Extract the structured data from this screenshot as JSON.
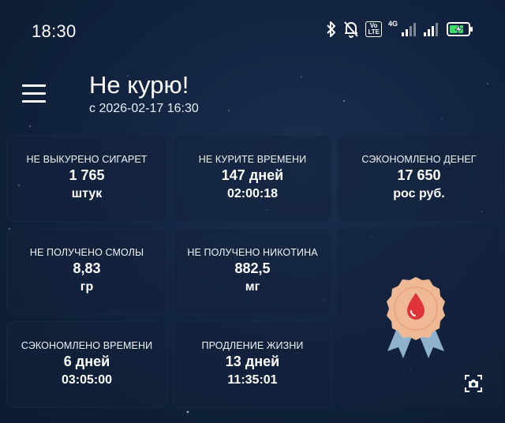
{
  "status_bar": {
    "time": "18:30",
    "volte_top": "Vo",
    "volte_bottom": "LTE",
    "network_type": "4G",
    "icons": [
      "bluetooth-icon",
      "bell-off-icon",
      "volte-icon",
      "signal-icon",
      "signal-icon",
      "battery-charging-icon"
    ]
  },
  "app_bar": {
    "title": "Не курю!",
    "subtitle": "с 2026-02-17 16:30"
  },
  "stats": [
    {
      "label": "НЕ ВЫКУРЕНО СИГАРЕТ",
      "value": "1 765",
      "unit": "штук"
    },
    {
      "label": "НЕ КУРИТЕ ВРЕМЕНИ",
      "value": "147 дней",
      "unit": "02:00:18"
    },
    {
      "label": "СЭКОНОМЛЕНО ДЕНЕГ",
      "value": "17 650",
      "unit": "рос руб."
    },
    {
      "label": "НЕ ПОЛУЧЕНО СМОЛЫ",
      "value": "8,83",
      "unit": "гр"
    },
    {
      "label": "НЕ ПОЛУЧЕНО НИКОТИНА",
      "value": "882,5",
      "unit": "мг"
    },
    {
      "label": "СЭКОНОМЛЕНО ВРЕМЕНИ",
      "value": "6 дней",
      "unit": "03:05:00"
    },
    {
      "label": "ПРОДЛЕНИЕ ЖИЗНИ",
      "value": "13 дней",
      "unit": "11:35:01"
    }
  ],
  "badge": {
    "icon": "blood-drop-award-icon"
  },
  "colors": {
    "accent_badge": "#f0b995",
    "drop": "#e0343c",
    "ribbon": "#8fb2cc",
    "battery_fill": "#3ddc68"
  }
}
